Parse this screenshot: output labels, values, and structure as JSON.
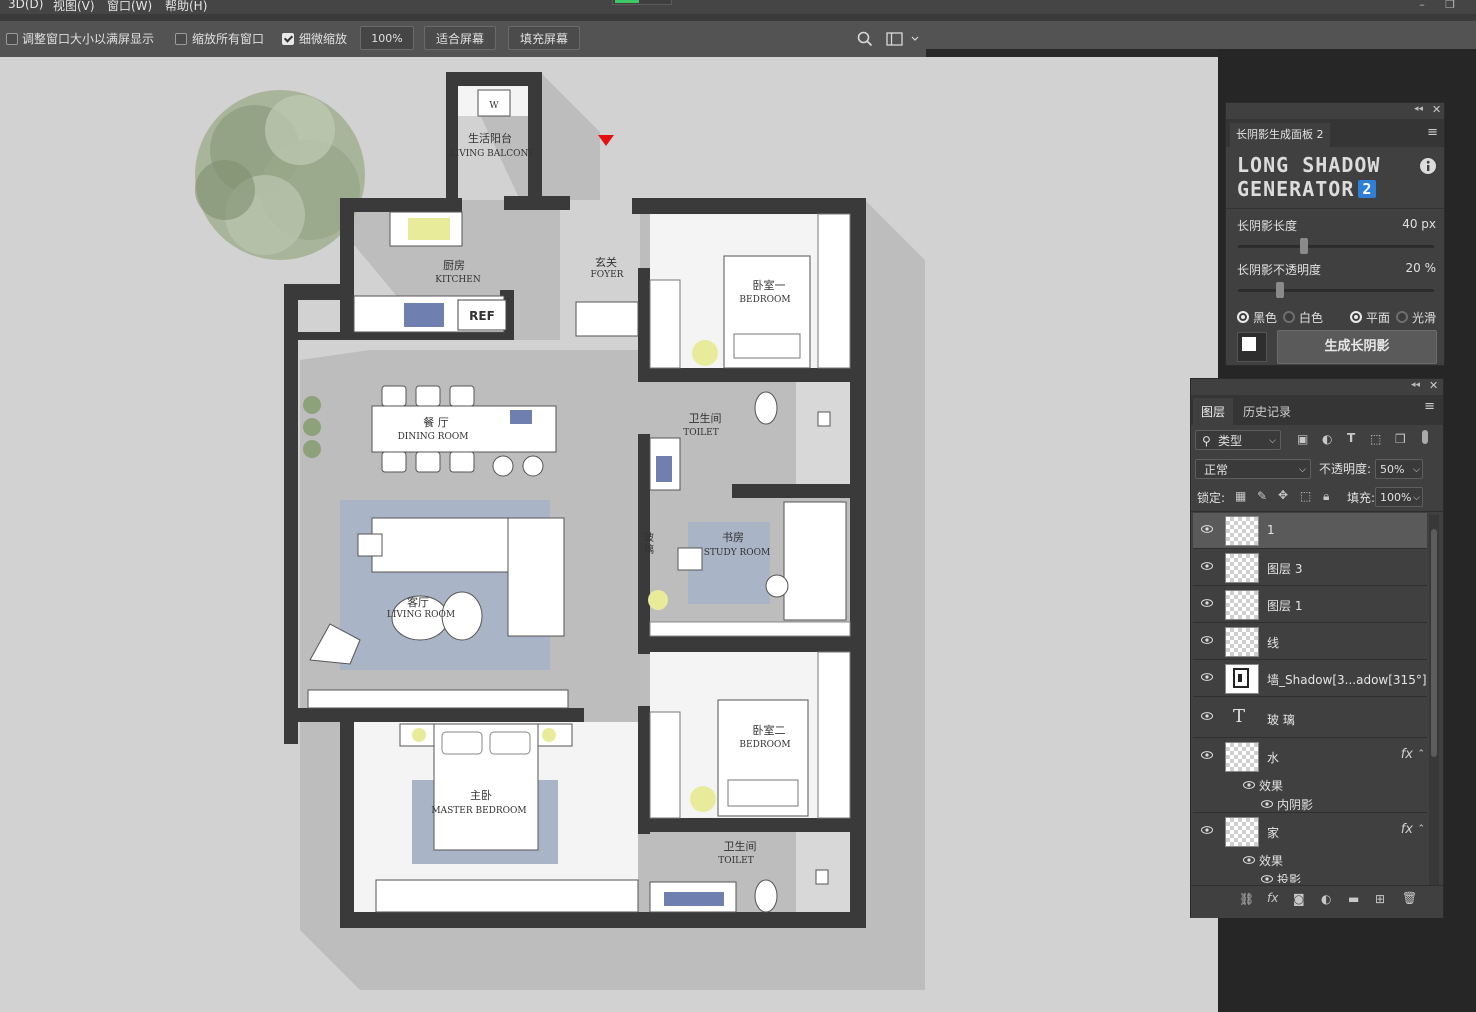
{
  "menu": [
    "3D(D)",
    "视图(V)",
    "窗口(W)",
    "帮助(H)"
  ],
  "options": {
    "resize_windows_label": "调整窗口大小以满屏显示",
    "resize_windows_checked": false,
    "zoom_all_label": "缩放所有窗口",
    "zoom_all_checked": false,
    "scrubby_zoom_label": "细微缩放",
    "scrubby_zoom_checked": true,
    "zoom_value": "100%",
    "fit_screen_label": "适合屏幕",
    "fill_screen_label": "填充屏幕"
  },
  "floorplan": {
    "rooms": [
      {
        "cn": "生活阳台",
        "en": "LIVING BALCONY"
      },
      {
        "cn": "厨房",
        "en": "KITCHEN"
      },
      {
        "cn": "玄关",
        "en": "FOYER"
      },
      {
        "cn": "卧室一",
        "en": "BEDROOM"
      },
      {
        "cn": "卫生间",
        "en": "TOILET"
      },
      {
        "cn": "餐 厅",
        "en": "DINING ROOM"
      },
      {
        "cn": "书房",
        "en": "STUDY ROOM"
      },
      {
        "cn": "客厅",
        "en": "LIVING ROOM"
      },
      {
        "cn": "卧室二",
        "en": "BEDROOM"
      },
      {
        "cn": "主卧",
        "en": "MASTER BEDROOM"
      },
      {
        "cn": "卫生间",
        "en": "TOILET"
      }
    ],
    "fridge_label": "REF",
    "washer_label": "W",
    "glass_label": [
      "玻",
      "璃"
    ]
  },
  "long_shadow_panel": {
    "tab": "长阴影生成面板 2",
    "title_line1": "LONG SHADOW",
    "title_line2": "GENERATOR",
    "title_badge": "2",
    "length_label": "长阴影长度",
    "length_value": "40 px",
    "length_fraction": 0.33,
    "opacity_label": "长阴影不透明度",
    "opacity_value": "20 %",
    "opacity_fraction": 0.2,
    "color_options": [
      {
        "label": "黑色",
        "selected": true
      },
      {
        "label": "白色",
        "selected": false
      }
    ],
    "style_options": [
      {
        "label": "平面",
        "selected": true
      },
      {
        "label": "光滑",
        "selected": false
      }
    ],
    "generate_label": "生成长阴影"
  },
  "layers_panel": {
    "tabs": [
      "图层",
      "历史记录"
    ],
    "filter_label": "类型",
    "blend_mode": "正常",
    "opacity_label": "不透明度:",
    "opacity_value": "50%",
    "lock_label": "锁定:",
    "fill_label": "填充:",
    "fill_value": "100%",
    "layers": [
      {
        "name": "1",
        "selected": true,
        "fx": false,
        "type": "pixel"
      },
      {
        "name": "图层 3",
        "selected": false,
        "fx": false,
        "type": "pixel"
      },
      {
        "name": "图层 1",
        "selected": false,
        "fx": false,
        "type": "pixel"
      },
      {
        "name": "线",
        "selected": false,
        "fx": false,
        "type": "pixel"
      },
      {
        "name": "墙_Shadow[3...adow[315°]",
        "selected": false,
        "fx": false,
        "type": "pixel"
      },
      {
        "name": "玻 璃",
        "selected": false,
        "fx": false,
        "type": "text"
      },
      {
        "name": "水",
        "selected": false,
        "fx": true,
        "effects_label": "效果",
        "effect": "内阴影"
      },
      {
        "name": "家",
        "selected": false,
        "fx": true,
        "effects_label": "效果",
        "effect": "投影"
      }
    ],
    "fx_label": "fx"
  }
}
